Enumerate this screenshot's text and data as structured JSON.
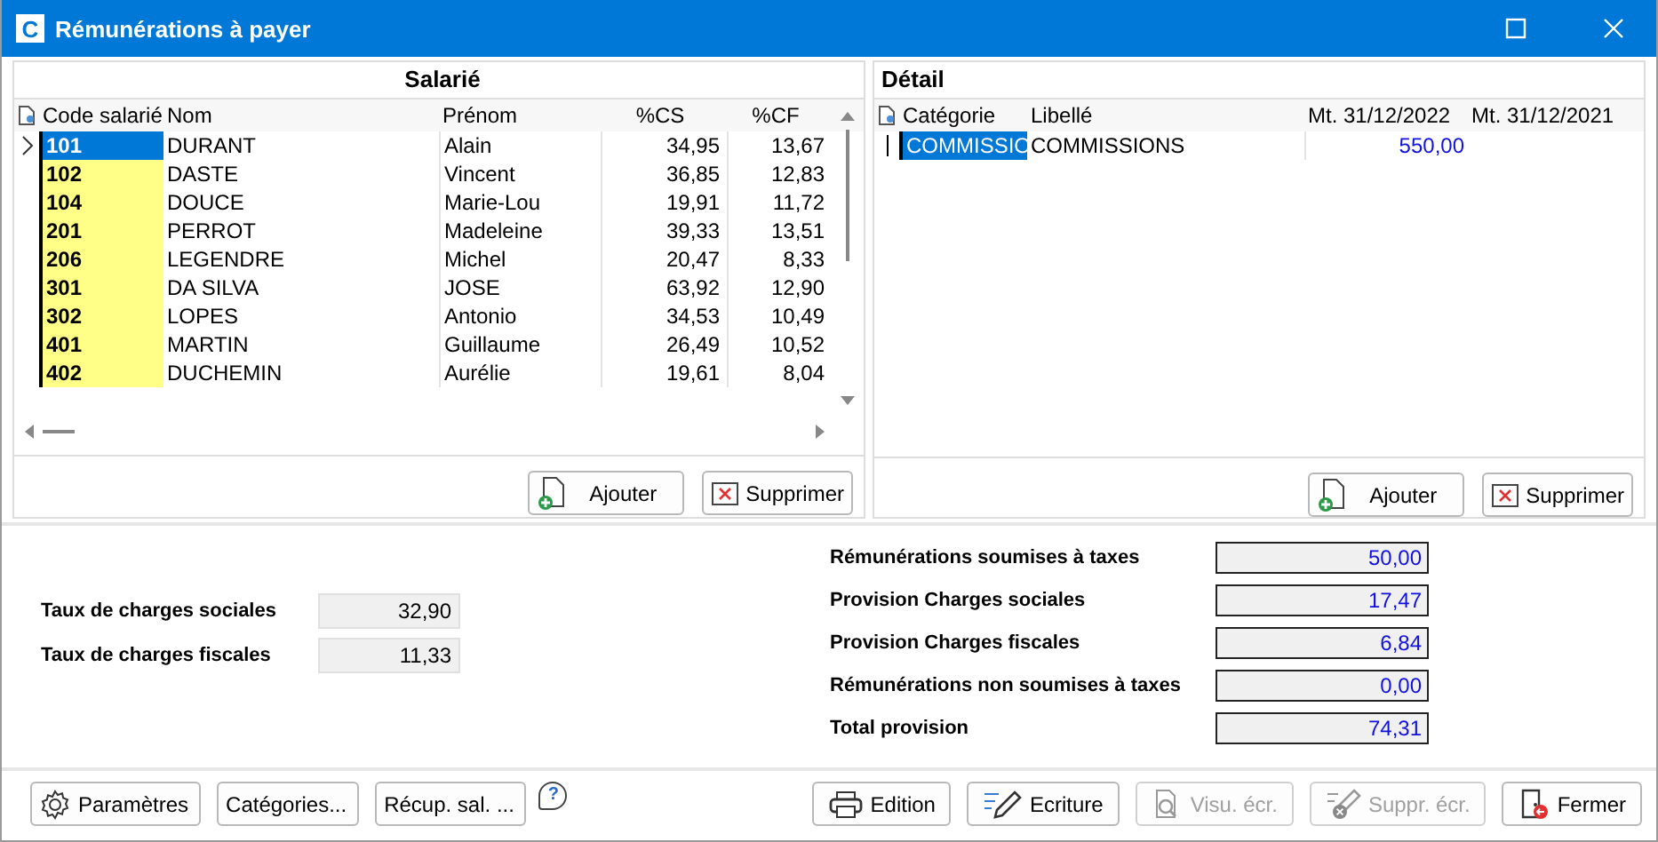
{
  "window": {
    "title": "Rémunérations à payer",
    "logo": "C"
  },
  "salarie": {
    "title": "Salarié",
    "columns": [
      "Code salarié",
      "Nom",
      "Prénom",
      "%CS",
      "%CF"
    ],
    "rows": [
      {
        "code": "101",
        "nom": "DURANT",
        "prenom": "Alain",
        "cs": "34,95",
        "cf": "13,67",
        "selected": true
      },
      {
        "code": "102",
        "nom": "DASTE",
        "prenom": "Vincent",
        "cs": "36,85",
        "cf": "12,83",
        "selected": false
      },
      {
        "code": "104",
        "nom": "DOUCE",
        "prenom": "Marie-Lou",
        "cs": "19,91",
        "cf": "11,72",
        "selected": false
      },
      {
        "code": "201",
        "nom": "PERROT",
        "prenom": "Madeleine",
        "cs": "39,33",
        "cf": "13,51",
        "selected": false
      },
      {
        "code": "206",
        "nom": "LEGENDRE",
        "prenom": "Michel",
        "cs": "20,47",
        "cf": "8,33",
        "selected": false
      },
      {
        "code": "301",
        "nom": "DA SILVA",
        "prenom": "JOSE",
        "cs": "63,92",
        "cf": "12,90",
        "selected": false
      },
      {
        "code": "302",
        "nom": "LOPES",
        "prenom": "Antonio",
        "cs": "34,53",
        "cf": "10,49",
        "selected": false
      },
      {
        "code": "401",
        "nom": "MARTIN",
        "prenom": "Guillaume",
        "cs": "26,49",
        "cf": "10,52",
        "selected": false
      },
      {
        "code": "402",
        "nom": "DUCHEMIN",
        "prenom": "Aurélie",
        "cs": "19,61",
        "cf": "8,04",
        "selected": false
      }
    ],
    "buttons": [
      "Ajouter",
      "Supprimer"
    ]
  },
  "detail": {
    "title": "Détail",
    "columns": [
      "Catégorie",
      "Libellé",
      "Mt. 31/12/2022",
      "Mt. 31/12/2021"
    ],
    "rows": [
      {
        "categorie": "COMMISSIO",
        "libelle": "COMMISSIONS",
        "mt_2022": "550,00",
        "selected": true
      }
    ],
    "buttons": [
      "Ajouter",
      "Supprimer"
    ]
  },
  "taux": [
    {
      "label": "Taux de charges sociales",
      "value": "32,90"
    },
    {
      "label": "Taux de charges fiscales",
      "value": "11,33"
    }
  ],
  "totals": [
    {
      "label": "Rémunérations soumises à taxes",
      "value": "50,00"
    },
    {
      "label": "Provision Charges sociales",
      "value": "17,47"
    },
    {
      "label": "Provision Charges fiscales",
      "value": "6,84"
    },
    {
      "label": "Rémunérations non soumises à taxes",
      "value": "0,00"
    },
    {
      "label": "Total provision",
      "value": "74,31"
    }
  ],
  "footer_left": [
    {
      "label": "Paramètres",
      "disabled": false
    },
    {
      "label": "Catégories...",
      "disabled": false
    },
    {
      "label": "Récup. sal. ...",
      "disabled": false
    }
  ],
  "help": "?",
  "footer_right": [
    {
      "label": "Edition",
      "disabled": false
    },
    {
      "label": "Ecriture",
      "disabled": false
    },
    {
      "label": "Visu. écr.",
      "disabled": true
    },
    {
      "label": "Suppr. écr.",
      "disabled": true
    },
    {
      "label": "Fermer",
      "disabled": false
    }
  ]
}
